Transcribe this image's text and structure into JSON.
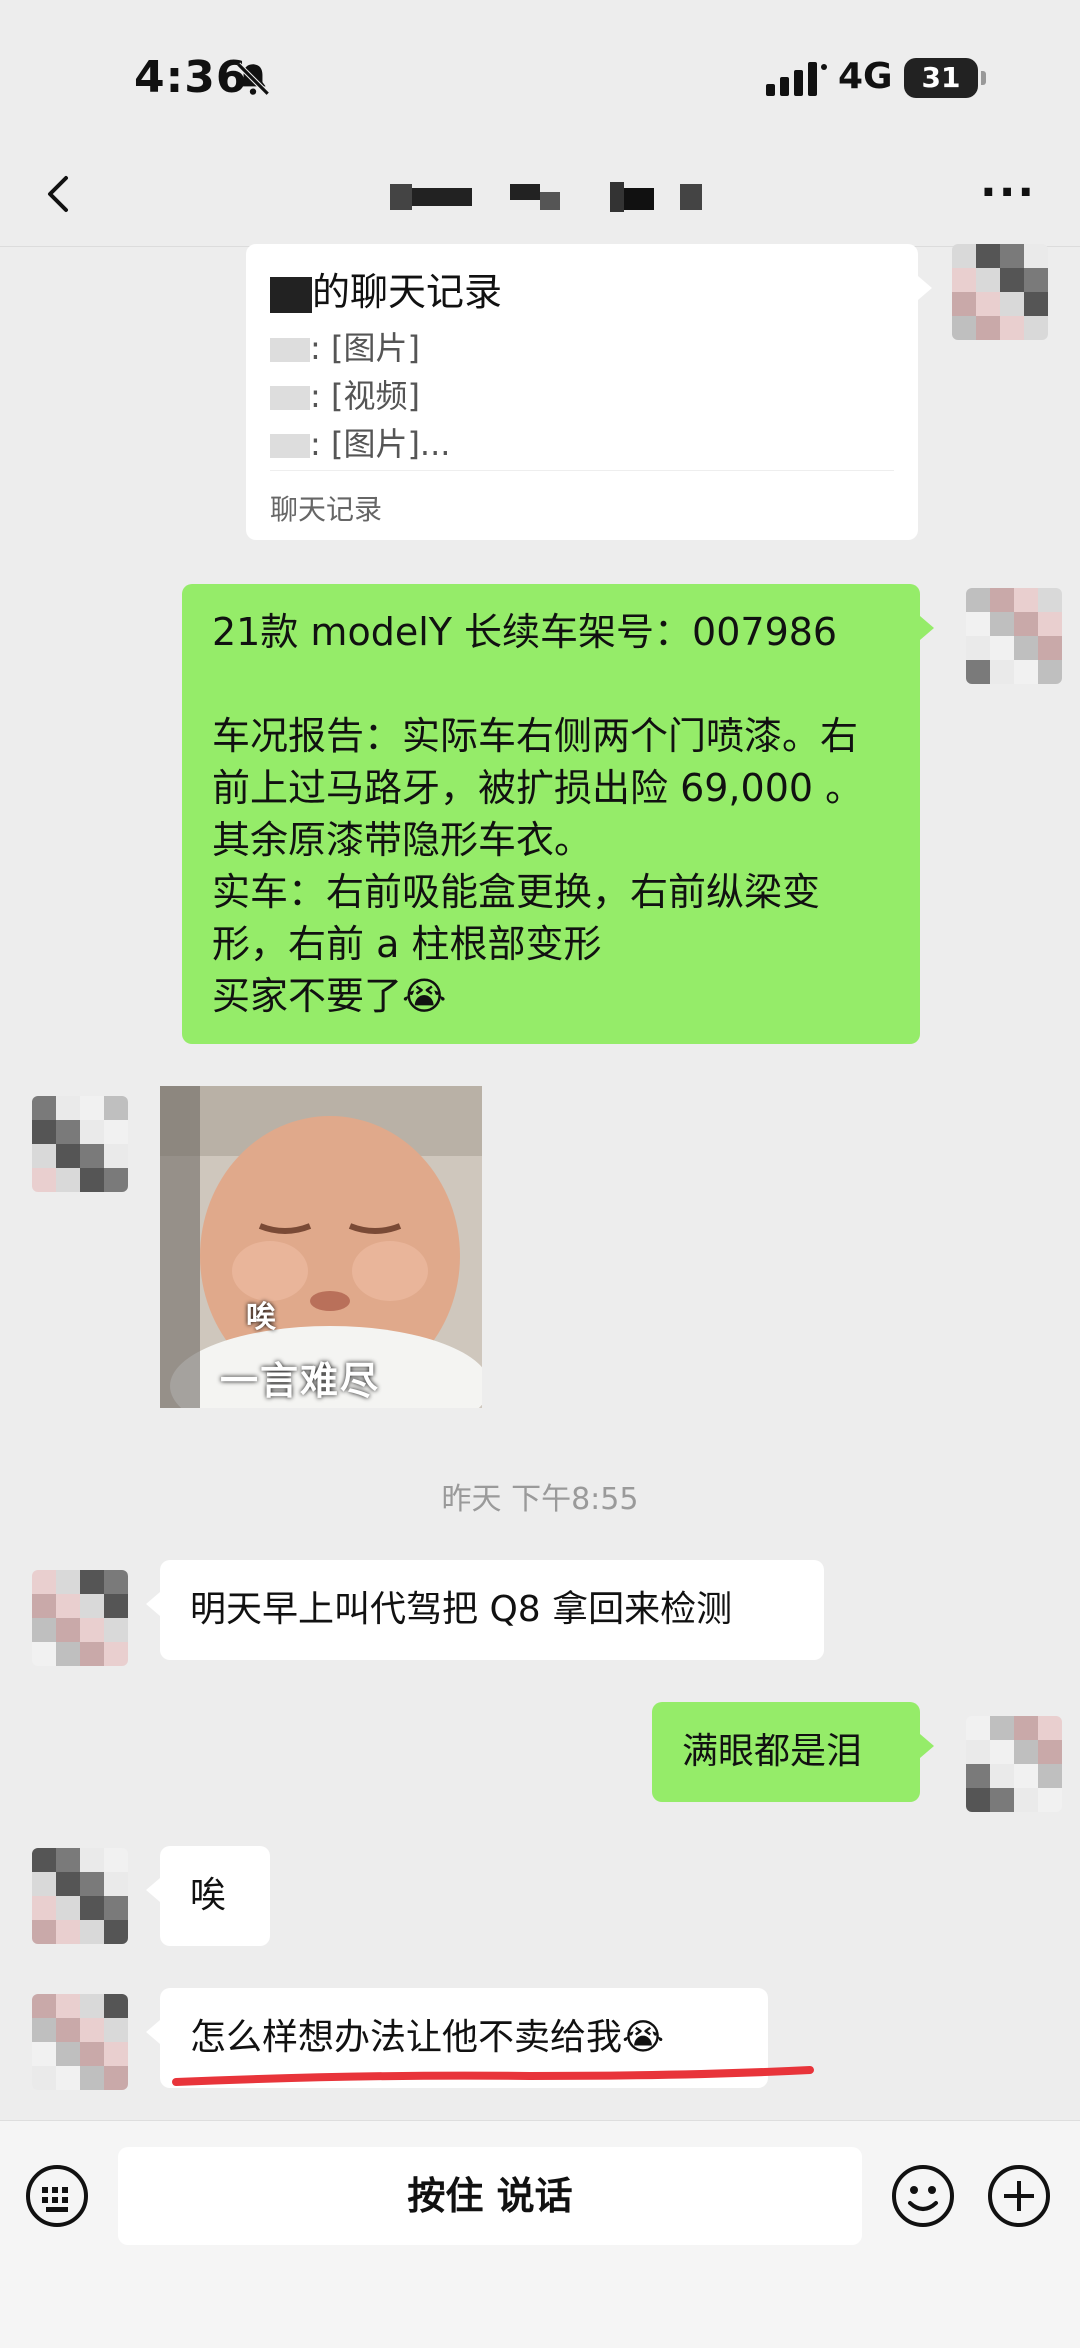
{
  "status_bar": {
    "time": "4:36",
    "network": "4G",
    "battery": "31"
  },
  "nav": {
    "more": "···"
  },
  "forward_card": {
    "title_suffix": "的聊天记录",
    "lines": [
      ": [图片]",
      ": [视频]",
      ": [图片]..."
    ],
    "footer": "聊天记录"
  },
  "messages": {
    "m1": "21款 modelY 长续车架号：007986\n\n车况报告：实际车右侧两个门喷漆。右前上过马路牙，被扩损出险 69,000 。其余原漆带隐形车衣。\n实车：右前吸能盒更换，右前纵梁变形，右前 a 柱根部变形\n买家不要了😭",
    "sticker_caption_small": "唉",
    "sticker_caption_big": "一言难尽",
    "timestamp": "昨天 下午8:55",
    "m2": "明天早上叫代驾把 Q8 拿回来检测",
    "m3": "满眼都是泪",
    "m4": "唉",
    "m5": "怎么样想办法让他不卖给我😭"
  },
  "bottom_bar": {
    "voice_label": "按住 说话"
  },
  "colors": {
    "green_bubble": "#95ec69",
    "white_bubble": "#ffffff",
    "underline": "#e8343a"
  }
}
